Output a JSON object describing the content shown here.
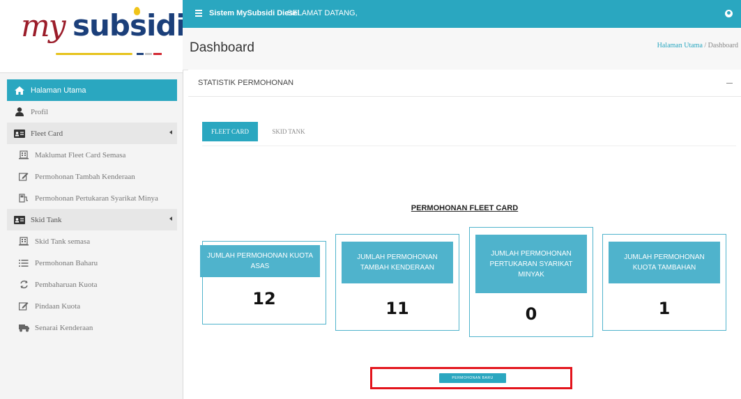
{
  "logo": {
    "text_my": "my",
    "text_subsidi": "subsidi"
  },
  "topbar": {
    "brand": "Sistem MySubsidi Diesel",
    "welcome": "SELAMAT DATANG,"
  },
  "header": {
    "title": "Dashboard",
    "breadcrumb": {
      "home": "Halaman Utama",
      "separator": "/",
      "current": "Dashboard"
    }
  },
  "sidebar": {
    "items": [
      {
        "label": "Halaman Utama",
        "icon": "home-icon",
        "type": "top",
        "active": true
      },
      {
        "label": "Profil",
        "icon": "user-icon",
        "type": "top"
      },
      {
        "label": "Fleet Card",
        "icon": "id-card-icon",
        "type": "group"
      },
      {
        "label": "Maklumat Fleet Card Semasa",
        "icon": "building-icon",
        "type": "sub"
      },
      {
        "label": "Permohonan Tambah Kenderaan",
        "icon": "edit-icon",
        "type": "sub"
      },
      {
        "label": "Permohonan Pertukaran Syarikat Minya",
        "icon": "fuel-icon",
        "type": "sub"
      },
      {
        "label": "Skid Tank",
        "icon": "id-card-icon",
        "type": "group"
      },
      {
        "label": "Skid Tank semasa",
        "icon": "building-icon",
        "type": "sub"
      },
      {
        "label": "Permohonan Baharu",
        "icon": "list-icon",
        "type": "sub"
      },
      {
        "label": "Pembaharuan Kuota",
        "icon": "refresh-icon",
        "type": "sub"
      },
      {
        "label": "Pindaan Kuota",
        "icon": "edit-icon",
        "type": "sub"
      },
      {
        "label": "Senarai Kenderaan",
        "icon": "truck-icon",
        "type": "sub"
      }
    ]
  },
  "panel": {
    "title": "STATISTIK PERMOHONAN",
    "tabs": [
      {
        "label": "FLEET CARD",
        "active": true
      },
      {
        "label": "SKID TANK",
        "active": false
      }
    ],
    "section_title": "PERMOHONAN FLEET CARD",
    "cards": [
      {
        "label": "JUMLAH PERMOHONAN KUOTA ASAS",
        "value": "12"
      },
      {
        "label": "JUMLAH PERMOHONAN TAMBAH KENDERAAN",
        "value": "11"
      },
      {
        "label": "JUMLAH PERMOHONAN PERTUKARAN SYARIKAT MINYAK",
        "value": "0"
      },
      {
        "label": "JUMLAH PERMOHONAN KUOTA TAMBAHAN",
        "value": "1"
      }
    ],
    "new_button": "PERMOHONAN BARU"
  },
  "colors": {
    "accent": "#2aa7c0",
    "card_accent": "#4fb3cc",
    "highlight_frame": "#e3141c",
    "logo_my": "#9b1d2a",
    "logo_subsidi": "#1b3f7a"
  }
}
